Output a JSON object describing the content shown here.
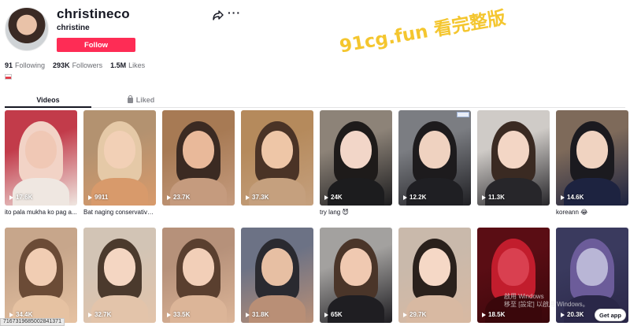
{
  "profile": {
    "username": "christineco",
    "subname": "christine",
    "follow_label": "Follow",
    "stats": [
      {
        "value": "91",
        "label": "Following"
      },
      {
        "value": "293K",
        "label": "Followers"
      },
      {
        "value": "1.5M",
        "label": "Likes"
      }
    ]
  },
  "watermark": "91cg.fun 看完整版",
  "tabs": {
    "videos": "Videos",
    "liked": "Liked"
  },
  "videos": [
    {
      "views": "17.6K",
      "caption": "ito pala mukha ko pag a...",
      "c1": "#c23b4a",
      "c2": "#f2d3c6",
      "c3": "#efe7e1",
      "skin": "#f0c8b5"
    },
    {
      "views": "9911",
      "caption": "Bat naging conservative...",
      "c1": "#b39270",
      "c2": "#e5c9a7",
      "c3": "#d89a6b",
      "skin": "#f2d0b6"
    },
    {
      "views": "23.7K",
      "caption": "",
      "c1": "#a77a54",
      "c2": "#3b2a22",
      "c3": "#c59b7e",
      "skin": "#e9b99a"
    },
    {
      "views": "37.3K",
      "caption": "",
      "c1": "#b58a5c",
      "c2": "#4a3326",
      "c3": "#c5a07e",
      "skin": "#eec6a7"
    },
    {
      "views": "24K",
      "caption": "try lang 😈",
      "c1": "#8d8378",
      "c2": "#1e1b1a",
      "c3": "#1c1c1e",
      "skin": "#f2d6c8"
    },
    {
      "views": "12.2K",
      "caption": "",
      "c1": "#7b7d82",
      "c2": "#1d1b1d",
      "c3": "#1f1f23",
      "skin": "#efd2c0",
      "ad": true
    },
    {
      "views": "11.3K",
      "caption": "",
      "c1": "#cfcbc7",
      "c2": "#3a2a22",
      "c3": "#27262a",
      "skin": "#f3d6c5"
    },
    {
      "views": "14.6K",
      "caption": "koreann 😂",
      "c1": "#7e6a5a",
      "c2": "#1b1a1f",
      "c3": "#1d2340",
      "skin": "#f0d3c1"
    },
    {
      "views": "34.4K",
      "caption": "",
      "c1": "#c7a68b",
      "c2": "#6b4b36",
      "c3": "#e6c2a2",
      "skin": "#f1cdb3"
    },
    {
      "views": "32.7K",
      "caption": "",
      "c1": "#d2c4b5",
      "c2": "#4b3a2d",
      "c3": "#e3c4aa",
      "skin": "#f4d6c2"
    },
    {
      "views": "33.5K",
      "caption": "",
      "c1": "#b6917a",
      "c2": "#5a3f2f",
      "c3": "#dcb598",
      "skin": "#f2cfb8"
    },
    {
      "views": "31.8K",
      "caption": "",
      "c1": "#6c7285",
      "c2": "#2a2a30",
      "c3": "#b98f76",
      "skin": "#e7bfa3"
    },
    {
      "views": "65K",
      "caption": "",
      "c1": "#a3a19f",
      "c2": "#4a3529",
      "c3": "#1f1e22",
      "skin": "#f0c9b1"
    },
    {
      "views": "29.7K",
      "caption": "",
      "c1": "#c9b9ab",
      "c2": "#2a211c",
      "c3": "#d8b9a2",
      "skin": "#f5d8c6"
    },
    {
      "views": "18.5K",
      "caption": "",
      "c1": "#5a0d14",
      "c2": "#c21d2d",
      "c3": "#3a070b",
      "skin": "#d94050"
    },
    {
      "views": "20.3K",
      "caption": "",
      "c1": "#3a3a5e",
      "c2": "#6c5c9a",
      "c3": "#2a2748",
      "skin": "#b9b6d6"
    }
  ],
  "overlay": {
    "url_tip": "7167319685002841371",
    "windows_line1": "啟用 Windows",
    "windows_line2": "移至 [設定] 以啟用 Windows。",
    "get_app": "Get app"
  }
}
